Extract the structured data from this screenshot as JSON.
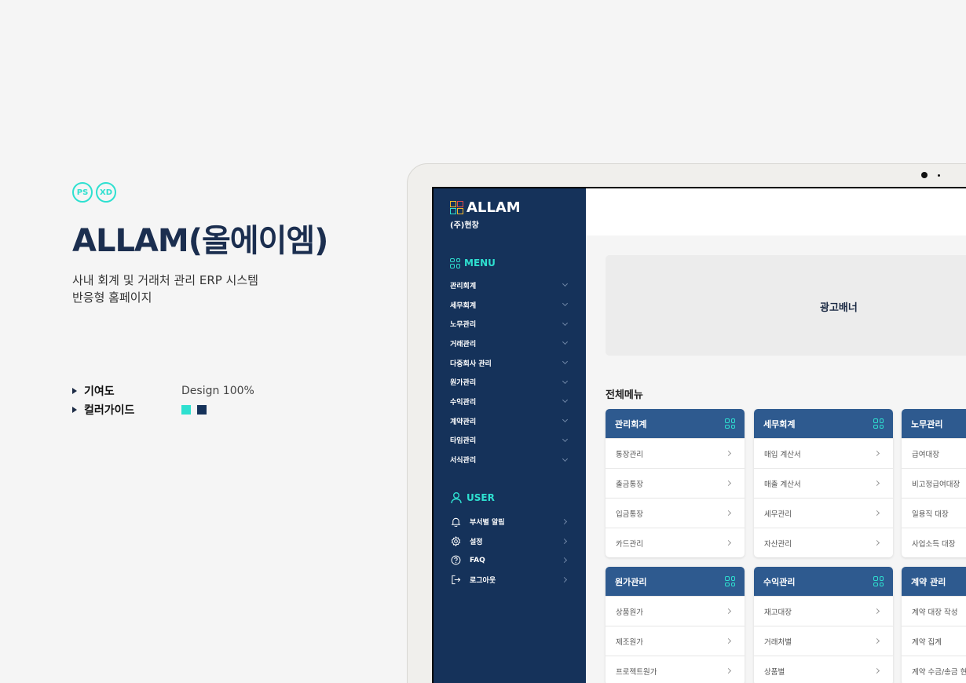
{
  "intro": {
    "badges": [
      "PS",
      "XD"
    ],
    "title": "ALLAM(올에이엠)",
    "description_line1": "사내 회계 및 거래처 관리 ERP 시스템",
    "description_line2": "반응형 홈페이지",
    "contribution_label": "기여도",
    "contribution_value": "Design 100%",
    "color_guide_label": "컬러가이드",
    "colors": [
      "#2ee0d0",
      "#15325a"
    ]
  },
  "sidebar": {
    "brand": "ALLAM",
    "company": "(주)현창",
    "menu_title": "MENU",
    "menu_items": [
      "관리회계",
      "세무회계",
      "노무관리",
      "거래관리",
      "다중회사 관리",
      "원가관리",
      "수익관리",
      "계약관리",
      "타임관리",
      "서식관리"
    ],
    "user_title": "USER",
    "user_items": [
      {
        "label": "부서별 알림",
        "icon": "bell-icon"
      },
      {
        "label": "설정",
        "icon": "gear-icon"
      },
      {
        "label": "FAQ",
        "icon": "question-icon"
      },
      {
        "label": "로그아웃",
        "icon": "logout-icon"
      }
    ]
  },
  "main": {
    "banner": "광고배너",
    "all_menu_title": "전체메뉴",
    "cards": [
      {
        "title": "관리회계",
        "items": [
          "통장관리",
          "출금통장",
          "입금통장",
          "카드관리"
        ]
      },
      {
        "title": "세무회계",
        "items": [
          "매입 계산서",
          "매출 계산서",
          "세무관리",
          "자산관리"
        ]
      },
      {
        "title": "노무관리",
        "items": [
          "급여대장",
          "비고정급여대장",
          "일용직 대장",
          "사업소득 대장"
        ]
      },
      {
        "title": "원가관리",
        "items": [
          "상품원가",
          "제조원가",
          "프로젝트원가"
        ]
      },
      {
        "title": "수익관리",
        "items": [
          "재고대장",
          "거래처별",
          "상품별"
        ]
      },
      {
        "title": "계약 관리",
        "items": [
          "계약 대장 작성",
          "계약 집계",
          "계약 수금/송금 현"
        ]
      }
    ]
  }
}
